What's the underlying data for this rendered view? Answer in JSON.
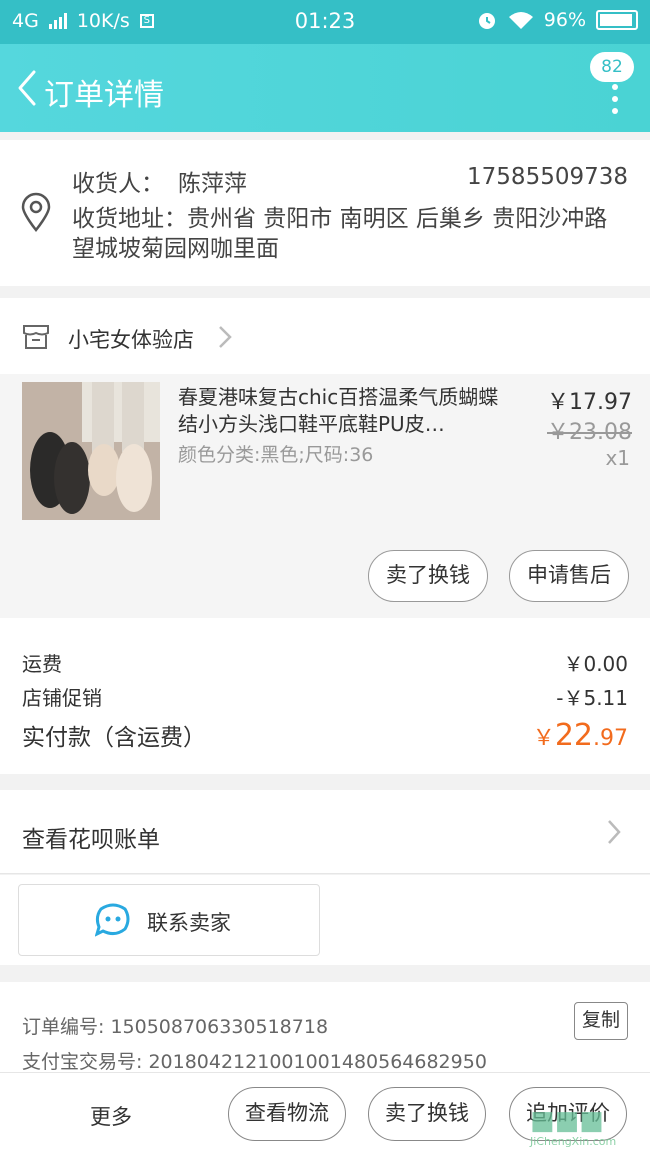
{
  "status_bar": {
    "network": "4G",
    "speed": "10K/s",
    "s_icon_text": "S",
    "time": "01:23",
    "battery": "96%"
  },
  "header": {
    "title": "订单详情",
    "badge": "82"
  },
  "address": {
    "receiver_label": "收货人：",
    "receiver_name": "陈萍萍",
    "phone": "17585509738",
    "address_label": "收货地址：",
    "address": "贵州省 贵阳市 南明区 后巢乡 贵阳沙冲路望城坡菊园网咖里面"
  },
  "shop": {
    "name": "小宅女体验店"
  },
  "product": {
    "name": "春夏港味复古chic百搭温柔气质蝴蝶结小方头浅口鞋平底鞋PU皮…",
    "spec": "颜色分类:黑色;尺码:36",
    "price": "￥17.97",
    "original_price": "￥23.08",
    "quantity": "x1",
    "btn_sell": "卖了换钱",
    "btn_aftersale": "申请售后"
  },
  "summary": {
    "shipping_label": "运费",
    "shipping_value": "￥0.00",
    "promo_label": "店铺促销",
    "promo_value": "-￥5.11",
    "total_label": "实付款（含运费）",
    "total_currency": "￥",
    "total_int": "22",
    "total_dec": ".97"
  },
  "huabei": {
    "label": "查看花呗账单"
  },
  "contact": {
    "label": "联系卖家"
  },
  "order_info": {
    "order_no": "订单编号: 1505087063305187​18",
    "alipay_no": "支付宝交易号: 2018042121001001480564682950",
    "copy": "复制"
  },
  "bottom_bar": {
    "more": "更多",
    "logistics": "查看物流",
    "sell": "卖了换钱",
    "review": "追加评价"
  },
  "watermark": {
    "text": "JiChengXin.com"
  },
  "colors": {
    "header": "#4ad3d4",
    "status": "#35bfc6",
    "total": "#f26b1d"
  }
}
